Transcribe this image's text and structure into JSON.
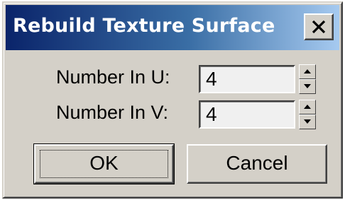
{
  "dialog": {
    "title": "Rebuild Texture Surface",
    "close_icon": "close-x-icon"
  },
  "fields": [
    {
      "label": "Number In U:",
      "value": "4"
    },
    {
      "label": "Number In V:",
      "value": "4"
    }
  ],
  "buttons": {
    "ok_label": "OK",
    "cancel_label": "Cancel"
  },
  "colors": {
    "dialog_face": "#d4d0c8",
    "title_gradient_start": "#0a246a",
    "title_gradient_end": "#a6caf0",
    "title_text": "#ffffff"
  }
}
